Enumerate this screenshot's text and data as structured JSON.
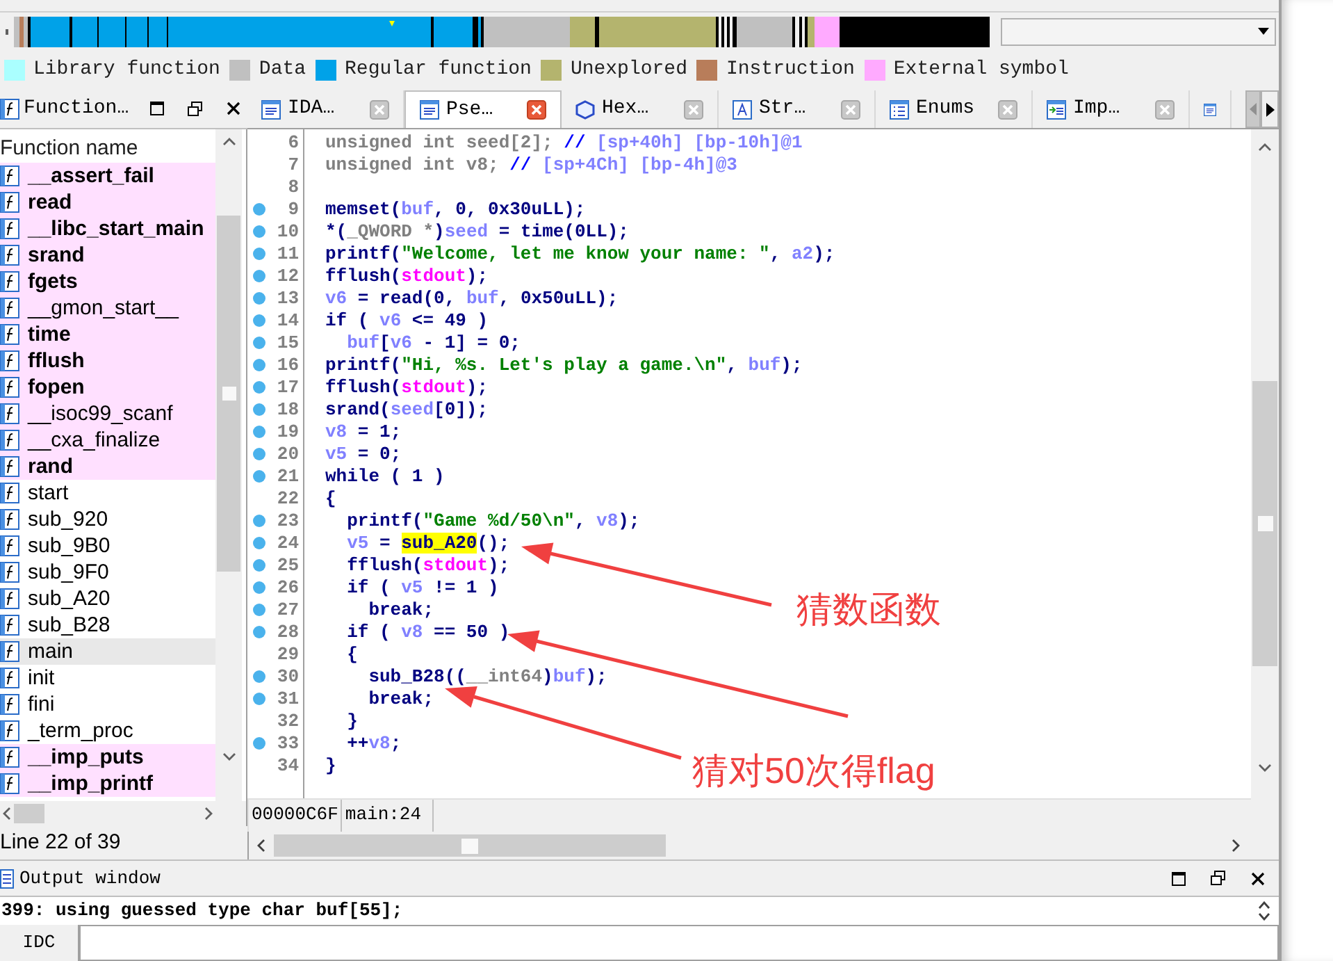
{
  "legend": [
    {
      "label": "Library function",
      "color": "#aaffff"
    },
    {
      "label": "Data",
      "color": "#c0c0c0"
    },
    {
      "label": "Regular function",
      "color": "#00a2e8"
    },
    {
      "label": "Unexplored",
      "color": "#b4b46e"
    },
    {
      "label": "Instruction",
      "color": "#b87d5a"
    },
    {
      "label": "External symbol",
      "color": "#ffaaff"
    }
  ],
  "functions_panel": {
    "title": "Function…",
    "column_header": "Function name",
    "status": "Line 22 of 39",
    "functions": [
      {
        "name": "__assert_fail",
        "kind": "import",
        "selected": false
      },
      {
        "name": "read",
        "kind": "import",
        "selected": false
      },
      {
        "name": "__libc_start_main",
        "kind": "import",
        "selected": false
      },
      {
        "name": "srand",
        "kind": "import",
        "selected": false
      },
      {
        "name": "fgets",
        "kind": "import",
        "selected": false
      },
      {
        "name": "__gmon_start__",
        "kind": "external",
        "selected": false
      },
      {
        "name": "time",
        "kind": "import",
        "selected": false
      },
      {
        "name": "fflush",
        "kind": "import",
        "selected": false
      },
      {
        "name": "fopen",
        "kind": "import",
        "selected": false
      },
      {
        "name": "__isoc99_scanf",
        "kind": "external",
        "selected": false
      },
      {
        "name": "__cxa_finalize",
        "kind": "external",
        "selected": false
      },
      {
        "name": "rand",
        "kind": "import",
        "selected": false
      },
      {
        "name": "start",
        "kind": "regular",
        "selected": false
      },
      {
        "name": "sub_920",
        "kind": "regular",
        "selected": false
      },
      {
        "name": "sub_9B0",
        "kind": "regular",
        "selected": false
      },
      {
        "name": "sub_9F0",
        "kind": "regular",
        "selected": false
      },
      {
        "name": "sub_A20",
        "kind": "regular",
        "selected": false
      },
      {
        "name": "sub_B28",
        "kind": "regular",
        "selected": false
      },
      {
        "name": "main",
        "kind": "regular",
        "selected": true
      },
      {
        "name": "init",
        "kind": "regular",
        "selected": false
      },
      {
        "name": "fini",
        "kind": "regular",
        "selected": false
      },
      {
        "name": "_term_proc",
        "kind": "regular",
        "selected": false
      },
      {
        "name": "__imp_puts",
        "kind": "import",
        "selected": false
      },
      {
        "name": "__imp_printf",
        "kind": "import",
        "selected": false
      }
    ]
  },
  "tabs": [
    {
      "label": "IDA…",
      "kind": "view",
      "selected": false
    },
    {
      "label": "Pse…",
      "kind": "view",
      "selected": true
    },
    {
      "label": "Hex…",
      "kind": "hex",
      "selected": false
    },
    {
      "label": "Str…",
      "kind": "strings",
      "selected": false
    },
    {
      "label": "Enums",
      "kind": "list",
      "selected": false
    },
    {
      "label": "Imp…",
      "kind": "imports",
      "selected": false
    },
    {
      "kind": "view",
      "selected": false
    }
  ],
  "code": {
    "lines": [
      {
        "number": "6",
        "breakpoint": false,
        "tokens": [
          {
            "kind": "decl",
            "text": "unsigned int seed[2]; "
          },
          {
            "kind": "comment",
            "text": "// "
          },
          {
            "kind": "var",
            "text": "[sp+40h] [bp-10h]@1"
          }
        ]
      },
      {
        "number": "7",
        "breakpoint": false,
        "tokens": [
          {
            "kind": "decl",
            "text": "unsigned int v8; "
          },
          {
            "kind": "comment",
            "text": "// "
          },
          {
            "kind": "var",
            "text": "[sp+4Ch] [bp-4h]@3"
          }
        ]
      },
      {
        "number": "8",
        "breakpoint": false
      },
      {
        "number": "9",
        "breakpoint": true,
        "tokens": [
          {
            "kind": "code",
            "text": "memset("
          },
          {
            "kind": "var",
            "text": "buf"
          },
          {
            "kind": "code",
            "text": ", 0, 0x30uLL);"
          }
        ]
      },
      {
        "number": "10",
        "breakpoint": true,
        "tokens": [
          {
            "kind": "code",
            "text": "*("
          },
          {
            "kind": "decl",
            "text": "_QWORD *"
          },
          {
            "kind": "code",
            "text": ")"
          },
          {
            "kind": "var",
            "text": "seed"
          },
          {
            "kind": "code",
            "text": " = time(0LL);"
          }
        ]
      },
      {
        "number": "11",
        "breakpoint": true,
        "tokens": [
          {
            "kind": "code",
            "text": "printf("
          },
          {
            "kind": "string",
            "text": "\"Welcome, let me know your name: \""
          },
          {
            "kind": "code",
            "text": ", "
          },
          {
            "kind": "var",
            "text": "a2"
          },
          {
            "kind": "code",
            "text": ");"
          }
        ]
      },
      {
        "number": "12",
        "breakpoint": true,
        "tokens": [
          {
            "kind": "code",
            "text": "fflush("
          },
          {
            "kind": "global",
            "text": "stdout"
          },
          {
            "kind": "code",
            "text": ");"
          }
        ]
      },
      {
        "number": "13",
        "breakpoint": true,
        "tokens": [
          {
            "kind": "var",
            "text": "v6"
          },
          {
            "kind": "code",
            "text": " = read(0, "
          },
          {
            "kind": "var",
            "text": "buf"
          },
          {
            "kind": "code",
            "text": ", 0x50uLL);"
          }
        ]
      },
      {
        "number": "14",
        "breakpoint": true,
        "tokens": [
          {
            "kind": "code",
            "text": "if ( "
          },
          {
            "kind": "var",
            "text": "v6"
          },
          {
            "kind": "code",
            "text": " <= 49 )"
          }
        ]
      },
      {
        "number": "15",
        "breakpoint": true,
        "tokens": [
          {
            "kind": "var",
            "text": "  buf"
          },
          {
            "kind": "code",
            "text": "["
          },
          {
            "kind": "var",
            "text": "v6"
          },
          {
            "kind": "code",
            "text": " - 1] = 0;"
          }
        ]
      },
      {
        "number": "16",
        "breakpoint": true,
        "tokens": [
          {
            "kind": "code",
            "text": "printf("
          },
          {
            "kind": "string",
            "text": "\"Hi, %s. Let's play a game.\\n\""
          },
          {
            "kind": "code",
            "text": ", "
          },
          {
            "kind": "var",
            "text": "buf"
          },
          {
            "kind": "code",
            "text": ");"
          }
        ]
      },
      {
        "number": "17",
        "breakpoint": true,
        "tokens": [
          {
            "kind": "code",
            "text": "fflush("
          },
          {
            "kind": "global",
            "text": "stdout"
          },
          {
            "kind": "code",
            "text": ");"
          }
        ]
      },
      {
        "number": "18",
        "breakpoint": true,
        "tokens": [
          {
            "kind": "code",
            "text": "srand("
          },
          {
            "kind": "var",
            "text": "seed"
          },
          {
            "kind": "code",
            "text": "[0]);"
          }
        ]
      },
      {
        "number": "19",
        "breakpoint": true,
        "tokens": [
          {
            "kind": "var",
            "text": "v8"
          },
          {
            "kind": "code",
            "text": " = 1;"
          }
        ]
      },
      {
        "number": "20",
        "breakpoint": true,
        "tokens": [
          {
            "kind": "var",
            "text": "v5"
          },
          {
            "kind": "code",
            "text": " = 0;"
          }
        ]
      },
      {
        "number": "21",
        "breakpoint": true,
        "tokens": [
          {
            "kind": "code",
            "text": "while ( 1 )"
          }
        ]
      },
      {
        "number": "22",
        "breakpoint": false,
        "tokens": [
          {
            "kind": "code",
            "text": "{"
          }
        ]
      },
      {
        "number": "23",
        "breakpoint": true,
        "tokens": [
          {
            "kind": "code",
            "text": "  printf("
          },
          {
            "kind": "string",
            "text": "\"Game %d/50\\n\""
          },
          {
            "kind": "code",
            "text": ", "
          },
          {
            "kind": "var",
            "text": "v8"
          },
          {
            "kind": "code",
            "text": ");"
          }
        ]
      },
      {
        "number": "24",
        "breakpoint": true,
        "tokens": [
          {
            "kind": "var",
            "text": "  v5"
          },
          {
            "kind": "code",
            "text": " = "
          },
          {
            "kind": "highlight",
            "text": "sub_A20"
          },
          {
            "kind": "code",
            "text": "();"
          }
        ]
      },
      {
        "number": "25",
        "breakpoint": true,
        "tokens": [
          {
            "kind": "code",
            "text": "  fflush("
          },
          {
            "kind": "global",
            "text": "stdout"
          },
          {
            "kind": "code",
            "text": ");"
          }
        ]
      },
      {
        "number": "26",
        "breakpoint": true,
        "tokens": [
          {
            "kind": "code",
            "text": "  if ( "
          },
          {
            "kind": "var",
            "text": "v5"
          },
          {
            "kind": "code",
            "text": " != 1 )"
          }
        ]
      },
      {
        "number": "27",
        "breakpoint": true,
        "tokens": [
          {
            "kind": "code",
            "text": "    break;"
          }
        ]
      },
      {
        "number": "28",
        "breakpoint": true,
        "tokens": [
          {
            "kind": "code",
            "text": "  if ( "
          },
          {
            "kind": "var",
            "text": "v8"
          },
          {
            "kind": "code",
            "text": " == 50 )"
          }
        ]
      },
      {
        "number": "29",
        "breakpoint": false,
        "tokens": [
          {
            "kind": "code",
            "text": "  {"
          }
        ]
      },
      {
        "number": "30",
        "breakpoint": true,
        "tokens": [
          {
            "kind": "code",
            "text": "    sub_B28(("
          },
          {
            "kind": "decl",
            "text": "__int64"
          },
          {
            "kind": "code",
            "text": ")"
          },
          {
            "kind": "var",
            "text": "buf"
          },
          {
            "kind": "code",
            "text": ");"
          }
        ]
      },
      {
        "number": "31",
        "breakpoint": true,
        "tokens": [
          {
            "kind": "code",
            "text": "    break;"
          }
        ]
      },
      {
        "number": "32",
        "breakpoint": false,
        "tokens": [
          {
            "kind": "code",
            "text": "  }"
          }
        ]
      },
      {
        "number": "33",
        "breakpoint": true,
        "tokens": [
          {
            "kind": "code",
            "text": "  ++"
          },
          {
            "kind": "var",
            "text": "v8"
          },
          {
            "kind": "code",
            "text": ";"
          }
        ]
      },
      {
        "number": "34",
        "breakpoint": false,
        "tokens": [
          {
            "kind": "code",
            "text": "}"
          }
        ]
      }
    ]
  },
  "code_status": {
    "address": "00000C6F",
    "location": "main:24"
  },
  "annotations": [
    {
      "text": "猜数函数"
    },
    {
      "text": "猜对50次得flag"
    }
  ],
  "output": {
    "title": "Output window",
    "message": "399: using guessed type char buf[55];",
    "idc_button": "IDC"
  }
}
